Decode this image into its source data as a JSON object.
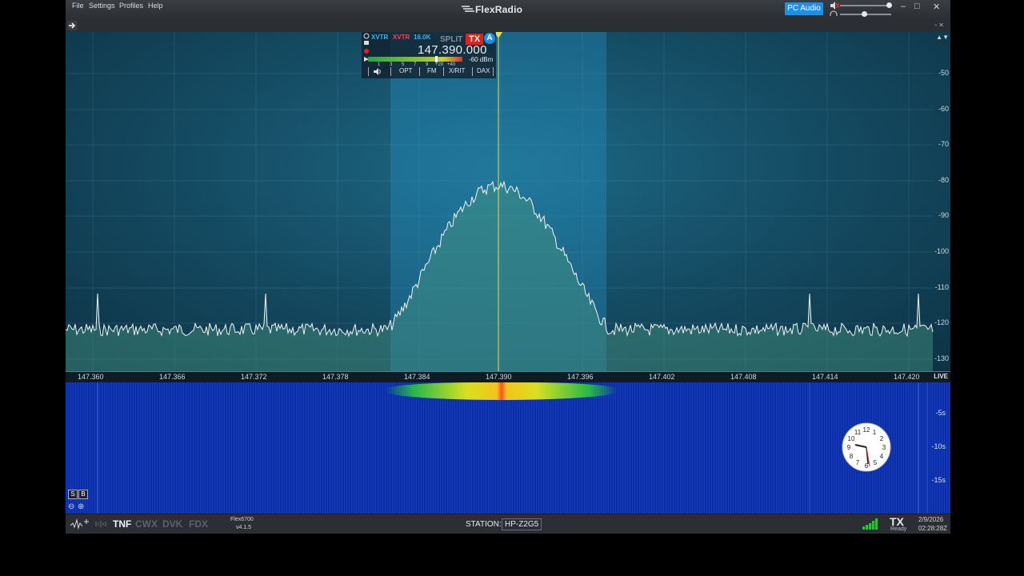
{
  "menu": {
    "file": "File",
    "settings": "Settings",
    "profiles": "Profiles",
    "help": "Help"
  },
  "brand": "FlexRadio",
  "pc_audio": "PC Audio",
  "window_controls": {
    "minimize": "–",
    "maximize": "□",
    "close": "✕"
  },
  "slice": {
    "xvtr1": "XVTR",
    "xvtr2": "XVTR",
    "bandwidth": "16.0K",
    "split": "SPLIT",
    "tx": "TX",
    "letter": "A",
    "frequency": "147.390.000",
    "dbm": "-60 dBm",
    "smeter_scale": [
      "1",
      "3",
      "5",
      "7",
      "9",
      "+20",
      "+40"
    ],
    "tabs": [
      "OPT",
      "FM",
      "X/RIT",
      "DAX"
    ]
  },
  "dbm_scale": [
    "-50",
    "-60",
    "-70",
    "-80",
    "-90",
    "-100",
    "-110",
    "-120",
    "-130"
  ],
  "freq_axis": [
    "147.360",
    "147.366",
    "147.372",
    "147.378",
    "147.384",
    "147.390",
    "147.396",
    "147.402",
    "147.408",
    "147.414",
    "147.420"
  ],
  "live": "LIVE",
  "waterfall_times": [
    "-5s",
    "-10s",
    "-15s"
  ],
  "clock_numbers": [
    "12",
    "1",
    "2",
    "3",
    "4",
    "5",
    "6",
    "7",
    "8",
    "9",
    "10",
    "11"
  ],
  "side_buttons": {
    "s": "S",
    "b": "B"
  },
  "statusbar": {
    "features": [
      "TNF",
      "CWX",
      "DVK",
      "FDX"
    ],
    "model": "Flex6700",
    "version": "v4.1.5",
    "station_label": "STATION:",
    "station_name": "HP-Z2G5",
    "tx": "TX",
    "tx_state": "Ready",
    "date": "2/9/2026",
    "time": "02:28:28Z"
  },
  "colors": {
    "accent": "#1d8fe6",
    "tx_red": "#e02020",
    "waterfall_blue": "#0a2fa8",
    "pan_bg": "#154e66"
  }
}
